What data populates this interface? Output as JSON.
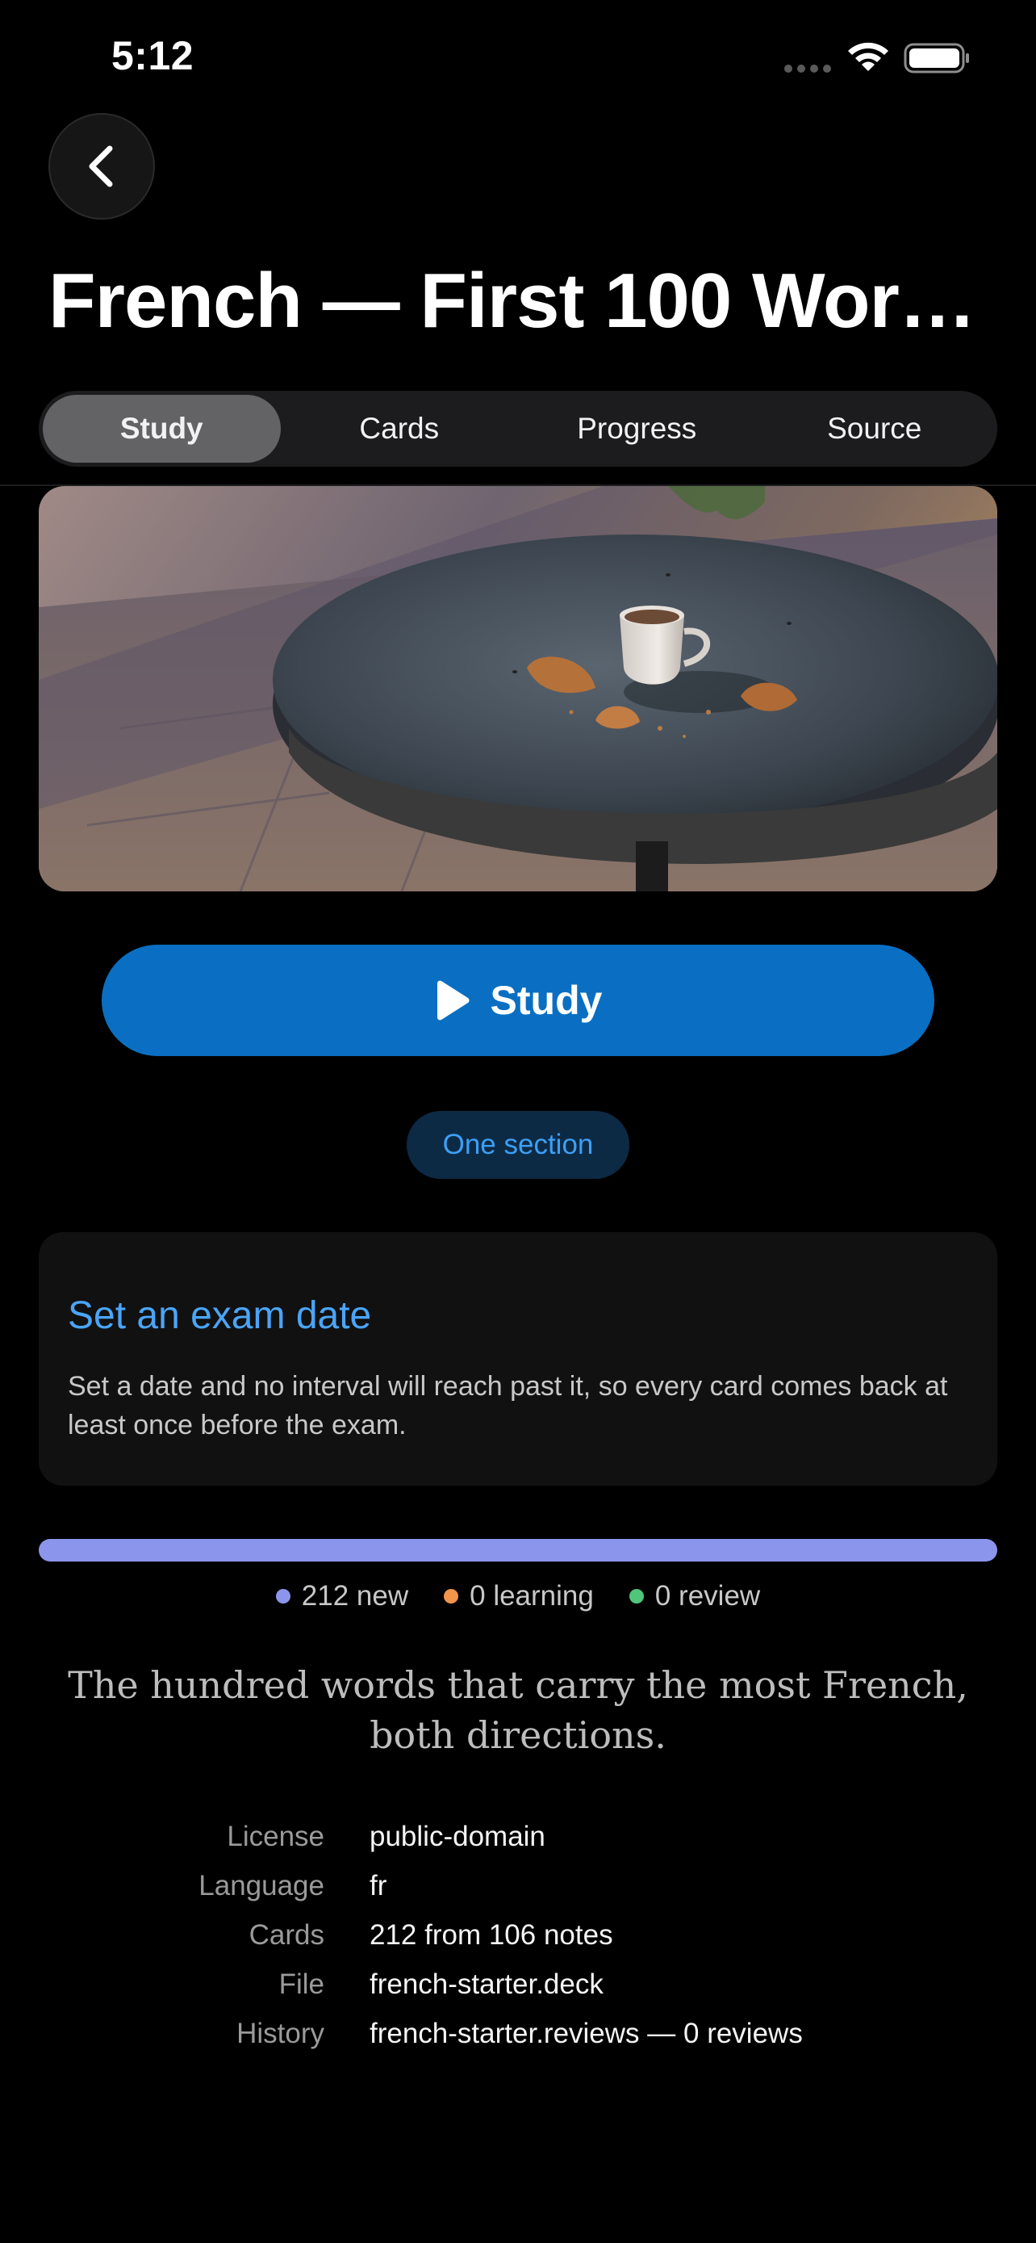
{
  "status_bar": {
    "time": "5:12"
  },
  "icons": {
    "back": "chevron-left-icon",
    "wifi": "wifi-icon",
    "battery": "battery-icon",
    "play": "play-icon"
  },
  "header": {
    "title": "French — First 100 Wor…"
  },
  "tabs": [
    {
      "label": "Study",
      "active": true
    },
    {
      "label": "Cards",
      "active": false
    },
    {
      "label": "Progress",
      "active": false
    },
    {
      "label": "Source",
      "active": false
    }
  ],
  "study_button": {
    "label": "Study",
    "color": "#0a6fc2"
  },
  "section_pill": {
    "label": "One section"
  },
  "exam_card": {
    "title": "Set an exam date",
    "body": "Set a date and no interval will reach past it, so every card comes back at least once before the exam."
  },
  "progress": {
    "new": 212,
    "learning": 0,
    "review": 0
  },
  "legend": [
    {
      "label": "212 new",
      "color": "#8c95ec"
    },
    {
      "label": "0 learning",
      "color": "#f0954a"
    },
    {
      "label": "0 review",
      "color": "#4fc67a"
    }
  ],
  "description": "The hundred words that carry the most French, both directions.",
  "info": [
    {
      "key": "License",
      "value": "public-domain"
    },
    {
      "key": "Language",
      "value": "fr"
    },
    {
      "key": "Cards",
      "value": "212 from 106 notes"
    },
    {
      "key": "File",
      "value": "french-starter.deck"
    },
    {
      "key": "History",
      "value": "french-starter.reviews — 0 reviews"
    }
  ]
}
